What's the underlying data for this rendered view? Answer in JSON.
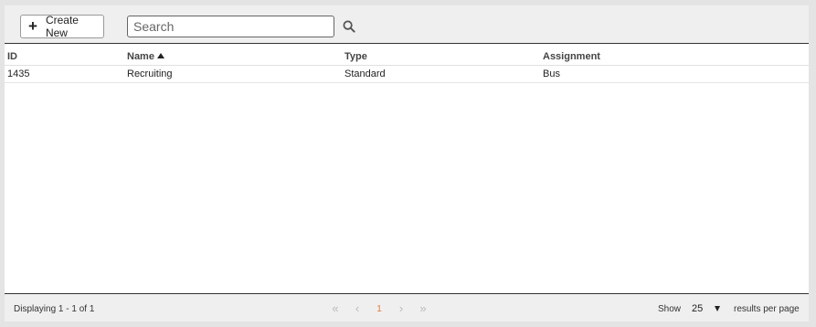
{
  "toolbar": {
    "create_label": "Create New",
    "search_placeholder": "Search"
  },
  "table": {
    "columns": [
      {
        "label": "ID"
      },
      {
        "label": "Name",
        "sorted": "asc"
      },
      {
        "label": "Type"
      },
      {
        "label": "Assignment"
      }
    ],
    "rows": [
      {
        "id": "1435",
        "name": "Recruiting",
        "type": "Standard",
        "assignment": "Bus"
      }
    ]
  },
  "footer": {
    "display_text": "Displaying 1 - 1 of 1",
    "pager": {
      "first": "«",
      "prev": "‹",
      "current": "1",
      "next": "›",
      "last": "»"
    },
    "show_label": "Show",
    "per_page_value": "25",
    "per_page_suffix": "results per page"
  },
  "colors": {
    "current_page": "#e8793c",
    "toolbar_bg": "#efefef"
  }
}
